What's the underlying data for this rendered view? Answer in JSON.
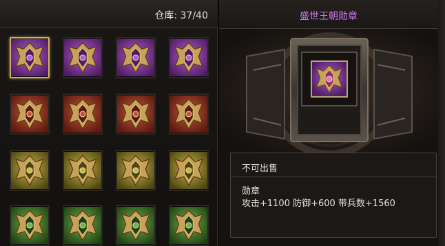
{
  "inventory": {
    "capacity_text": "仓库: 37/40",
    "slots": [
      {
        "tier": "purple",
        "selected": true
      },
      {
        "tier": "purple",
        "selected": false
      },
      {
        "tier": "purple",
        "selected": false
      },
      {
        "tier": "purple",
        "selected": false
      },
      {
        "tier": "red",
        "selected": false
      },
      {
        "tier": "red",
        "selected": false
      },
      {
        "tier": "red",
        "selected": false
      },
      {
        "tier": "red",
        "selected": false
      },
      {
        "tier": "yellow",
        "selected": false
      },
      {
        "tier": "yellow",
        "selected": false
      },
      {
        "tier": "yellow",
        "selected": false
      },
      {
        "tier": "yellow",
        "selected": false
      },
      {
        "tier": "green",
        "selected": false
      },
      {
        "tier": "green",
        "selected": false
      },
      {
        "tier": "green",
        "selected": false
      },
      {
        "tier": "green",
        "selected": false
      }
    ]
  },
  "detail": {
    "title": "盛世王朝勋章",
    "title_color": "#c978f0",
    "sell_status": "不可出售",
    "category": "勋章",
    "stats": "攻击+1100 防御+600 带兵数+1560"
  },
  "colors": {
    "purple": "#8c3aa6",
    "red": "#a33a22",
    "yellow": "#9a8a25",
    "green": "#3f7a2a",
    "selected_border": "#cfae63"
  },
  "icons": {
    "medal": "medal-icon"
  }
}
